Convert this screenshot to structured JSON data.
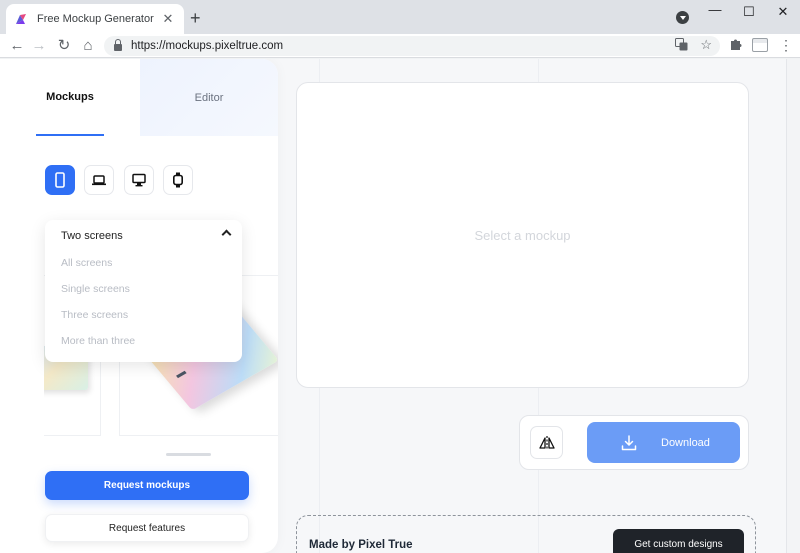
{
  "browser": {
    "tab_title": "Free Mockup Generator",
    "tab_close": "✕",
    "new_tab": "+",
    "url": "https://mockups.pixeltrue.com",
    "window": {
      "minimize": "—",
      "maximize": "☐",
      "close": "✕"
    },
    "nav": {
      "back": "←",
      "forward": "→",
      "reload": "↻",
      "home": "⌂"
    },
    "icons": {
      "translate": "translate-icon",
      "star": "☆",
      "extensions": "puzzle-icon",
      "menu": "⋮"
    }
  },
  "sidebar": {
    "tabs": [
      {
        "label": "Mockups",
        "active": true
      },
      {
        "label": "Editor",
        "active": false
      }
    ],
    "devices": [
      {
        "icon": "phone-icon",
        "active": true
      },
      {
        "icon": "laptop-icon",
        "active": false
      },
      {
        "icon": "desktop-icon",
        "active": false
      },
      {
        "icon": "watch-icon",
        "active": false
      }
    ],
    "screens_dropdown": {
      "selected": "Two screens",
      "options": [
        "All screens",
        "Single screens",
        "Three screens",
        "More than three"
      ]
    },
    "request_mockups_label": "Request mockups",
    "request_features_label": "Request features"
  },
  "preview": {
    "placeholder": "Select a mockup"
  },
  "actions": {
    "download_label": "Download"
  },
  "footer": {
    "made_by": "Made by Pixel True",
    "custom_designs_label": "Get custom designs"
  },
  "colors": {
    "accent": "#2f6ff5",
    "download_button": "#6b9cf6",
    "dark_button": "#1f2329"
  }
}
